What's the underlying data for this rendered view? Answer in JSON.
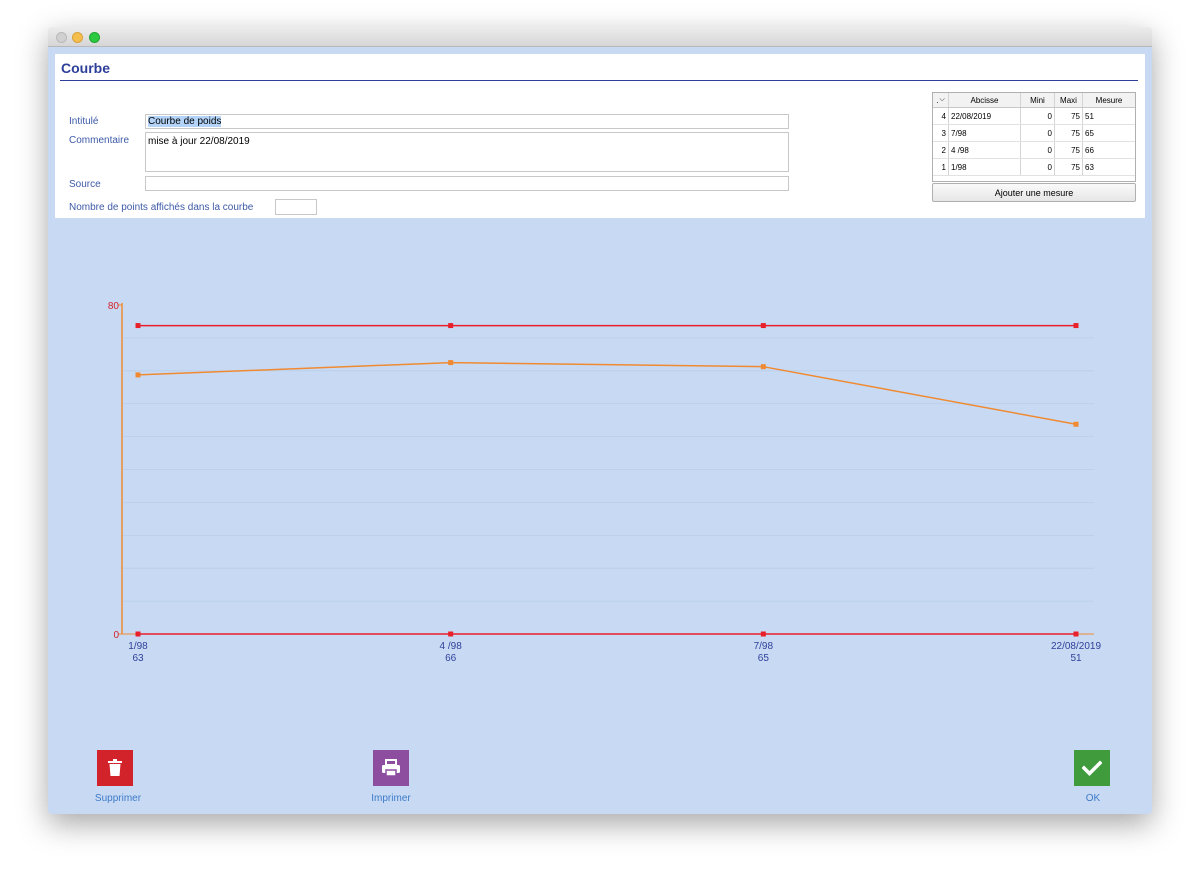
{
  "form": {
    "title": "Courbe",
    "intitule_label": "Intitulé",
    "intitule_value": "Courbe de poids",
    "commentaire_label": "Commentaire",
    "commentaire_value": "mise à jour  22/08/2019",
    "source_label": "Source",
    "source_value": "",
    "nb_points_label": "Nombre de points affichés dans la courbe",
    "nb_points_value": ""
  },
  "table": {
    "sort_label": ".",
    "columns": [
      "Abcisse",
      "Mini",
      "Maxi",
      "Mesure"
    ],
    "rows": [
      {
        "n": "4",
        "abcisse": "22/08/2019",
        "mini": "0",
        "maxi": "75",
        "mesure": "51"
      },
      {
        "n": "3",
        "abcisse": "7/98",
        "mini": "0",
        "maxi": "75",
        "mesure": "65"
      },
      {
        "n": "2",
        "abcisse": "4 /98",
        "mini": "0",
        "maxi": "75",
        "mesure": "66"
      },
      {
        "n": "1",
        "abcisse": "1/98",
        "mini": "0",
        "maxi": "75",
        "mesure": "63"
      }
    ],
    "add_button": "Ajouter une mesure"
  },
  "chart_data": {
    "type": "line",
    "categories": [
      "1/98",
      "4 /98",
      "7/98",
      "22/08/2019"
    ],
    "category_values": [
      "63",
      "66",
      "65",
      "51"
    ],
    "series": [
      {
        "values": [
          75,
          75,
          75,
          75
        ],
        "color": "#e8202a"
      },
      {
        "values": [
          63,
          66,
          65,
          51
        ],
        "color": "#f08a32"
      },
      {
        "values": [
          0,
          0,
          0,
          0
        ],
        "color": "#e8202a"
      }
    ],
    "ylim": [
      0,
      80
    ],
    "y_ticks": [
      "0",
      "80"
    ],
    "grid": true
  },
  "actions": {
    "delete_label": "Supprimer",
    "print_label": "Imprimer",
    "ok_label": "OK"
  },
  "colors": {
    "delete": "#d2232a",
    "print": "#8e4ea0",
    "ok": "#3f9b3c",
    "accent": "#2e3f9a"
  }
}
